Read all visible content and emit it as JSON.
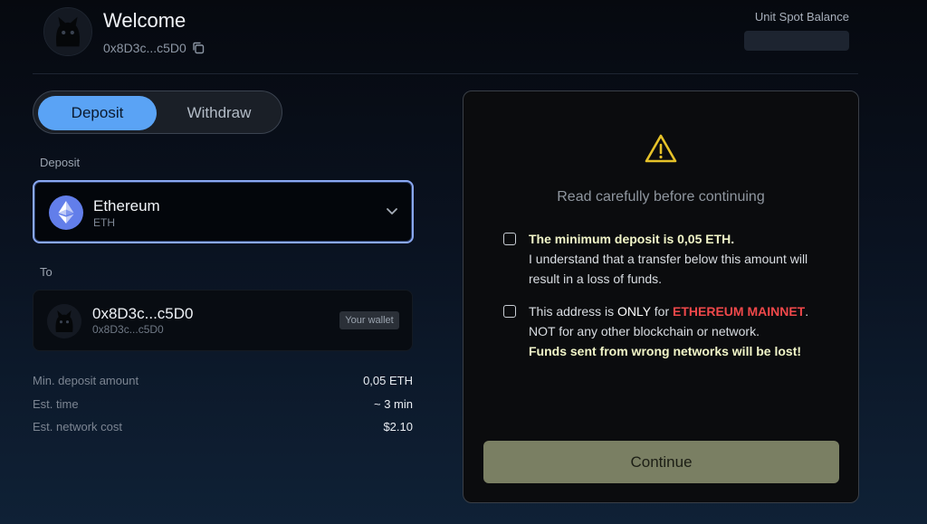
{
  "header": {
    "welcome": "Welcome",
    "address": "0x8D3c...c5D0",
    "balance_label": "Unit Spot Balance"
  },
  "tabs": [
    {
      "label": "Deposit",
      "active": true
    },
    {
      "label": "Withdraw",
      "active": false
    }
  ],
  "deposit_section": {
    "label": "Deposit",
    "asset": {
      "name": "Ethereum",
      "symbol": "ETH",
      "icon": "ethereum-icon"
    }
  },
  "to_section": {
    "label": "To",
    "address": "0x8D3c...c5D0",
    "address_sub": "0x8D3c...c5D0",
    "badge": "Your wallet"
  },
  "info": [
    {
      "key": "Min. deposit amount",
      "value": "0,05 ETH"
    },
    {
      "key": "Est. time",
      "value": "~ 3 min"
    },
    {
      "key": "Est. network cost",
      "value": "$2.10"
    }
  ],
  "panel": {
    "heading": "Read carefully before continuing",
    "ack1": {
      "bold": "The minimum deposit is 0,05 ETH.",
      "text": "I understand that a transfer below this amount will result in a loss of funds."
    },
    "ack2": {
      "prefix": "This address is ",
      "only": "ONLY",
      "for": " for ",
      "network": "ETHEREUM MAINNET",
      "period": ".",
      "line2": "NOT for any other blockchain or network.",
      "bold": "Funds sent from wrong networks will be lost!"
    },
    "continue_label": "Continue"
  },
  "colors": {
    "accent": "#5aa3f5",
    "warning": "#e6c229",
    "danger": "#f0484a",
    "highlight": "#f2f6c8",
    "continue_bg": "#7a7f63"
  }
}
